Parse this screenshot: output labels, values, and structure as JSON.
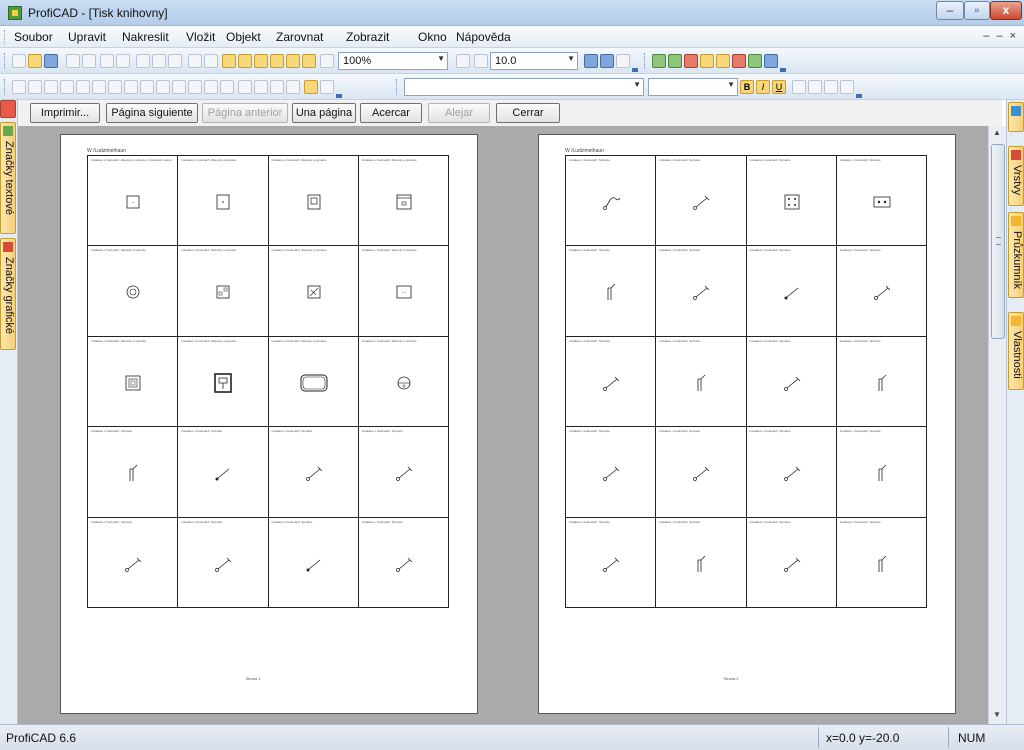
{
  "window": {
    "title": "ProfiCAD - [Tisk knihovny]"
  },
  "menu": {
    "items": [
      "Soubor",
      "Upravit",
      "Nakreslit",
      "Vložit",
      "Objekt",
      "Zarovnat",
      "Zobrazit",
      "Okno",
      "Nápověda"
    ],
    "mdi_controls": "– ‒ ×"
  },
  "toolbar": {
    "zoom_value": "100%",
    "line_width_value": "10.0",
    "font_style_buttons": [
      "B",
      "I",
      "U"
    ]
  },
  "preview_buttons": {
    "print": "Imprimir...",
    "next_page": "Página siguiente",
    "prev_page": "Página anterior",
    "one_page": "Una página",
    "zoom_in": "Acercar",
    "zoom_out": "Alejar",
    "close": "Cerrar"
  },
  "left_tabs": [
    "Značky textové",
    "Značky grafické"
  ],
  "right_tabs": [
    "Vrstvy",
    "Průzkumník",
    "Vlastnosti"
  ],
  "pages": [
    {
      "header": "W /Ludzimethaun",
      "footer": "Strana 1",
      "cells": [
        {
          "caption": "Instalace v budovách: Zásuvky a spínače v hotelovém pokoji",
          "symbol": "box-dots"
        },
        {
          "caption": "Instalace v budovách: Zásuvky a spínače",
          "symbol": "box-dot"
        },
        {
          "caption": "Instalace v budovách: Zásuvky a spínače",
          "symbol": "box-square"
        },
        {
          "caption": "Instalace v budovách: Zásuvky a spínače",
          "symbol": "box-lid"
        },
        {
          "caption": "Instalace v budovách: Zásuvky a spínače",
          "symbol": "box-circle"
        },
        {
          "caption": "Instalace v budovách: Zásuvky a spínače",
          "symbol": "box-small-sq"
        },
        {
          "caption": "Instalace v budovách: Zásuvky a spínače",
          "symbol": "box-diag"
        },
        {
          "caption": "Instalace v budovách: Zásuvky a spínače",
          "symbol": "box-three-dots"
        },
        {
          "caption": "Instalace v budovách: Zásuvky a spínače",
          "symbol": "box-nested"
        },
        {
          "caption": "Instalace v budovách: Zásuvky a spínače",
          "symbol": "box-bold"
        },
        {
          "caption": "Instalace v budovách: Zásuvky a spínače",
          "symbol": "rounded-rect"
        },
        {
          "caption": "Instalace v budovách: Zásuvky a spínače",
          "symbol": "circle-half"
        },
        {
          "caption": "Instalace v budovách: Spínače",
          "symbol": "switch-post"
        },
        {
          "caption": "Instalace v budovách: Spínače",
          "symbol": "switch-dot"
        },
        {
          "caption": "Instalace v budovách: Spínače",
          "symbol": "switch-open"
        },
        {
          "caption": "Instalace v budovách: Spínače",
          "symbol": "switch-open"
        },
        {
          "caption": "Instalace v budovách: Spínače",
          "symbol": "switch-open"
        },
        {
          "caption": "Instalace v budovách: Spínače",
          "symbol": "switch-open"
        },
        {
          "caption": "Instalace v budovách: Spínače",
          "symbol": "switch-dot"
        },
        {
          "caption": "Instalace v budovách: Spínače",
          "symbol": "switch-open"
        }
      ]
    },
    {
      "header": "W /Ludzimethaun",
      "footer": "Strana 2",
      "cells": [
        {
          "caption": "Instalace v budovách: Spínače",
          "symbol": "switch-wave"
        },
        {
          "caption": "Instalace v budovách: Spínače",
          "symbol": "switch-open"
        },
        {
          "caption": "Instalace v budovách: Spínače",
          "symbol": "box-four-dots"
        },
        {
          "caption": "Instalace v budovách: Spínače",
          "symbol": "box-two-dots"
        },
        {
          "caption": "Instalace v budovách: Spínače",
          "symbol": "switch-post"
        },
        {
          "caption": "Instalace v budovách: Spínače",
          "symbol": "switch-open"
        },
        {
          "caption": "Instalace v budovách: Spínače",
          "symbol": "switch-dot"
        },
        {
          "caption": "Instalace v budovách: Spínače",
          "symbol": "switch-open"
        },
        {
          "caption": "Instalace v budovách: Spínače",
          "symbol": "switch-open"
        },
        {
          "caption": "Instalace v budovách: Spínače",
          "symbol": "switch-post"
        },
        {
          "caption": "Instalace v budovách: Spínače",
          "symbol": "switch-open"
        },
        {
          "caption": "Instalace v budovách: Spínače",
          "symbol": "switch-post"
        },
        {
          "caption": "Instalace v budovách: Spínače",
          "symbol": "switch-open"
        },
        {
          "caption": "Instalace v budovách: Spínače",
          "symbol": "switch-open"
        },
        {
          "caption": "Instalace v budovách: Spínače",
          "symbol": "switch-open"
        },
        {
          "caption": "Instalace v budovách: Spínače",
          "symbol": "switch-post"
        },
        {
          "caption": "Instalace v budovách: Spínače",
          "symbol": "switch-open"
        },
        {
          "caption": "Instalace v budovách: Spínače",
          "symbol": "switch-post"
        },
        {
          "caption": "Instalace v budovách: Spínače",
          "symbol": "switch-open"
        },
        {
          "caption": "Instalace v budovách: Spínače",
          "symbol": "switch-post"
        }
      ]
    }
  ],
  "status": {
    "app": "ProfiCAD 6.6",
    "coords": "x=0.0  y=-20.0",
    "num": "NUM"
  },
  "colors": {
    "accent": "#3d6fb3",
    "tab_fill": "#f6cf77",
    "preview_bg": "#aaaaaa"
  }
}
